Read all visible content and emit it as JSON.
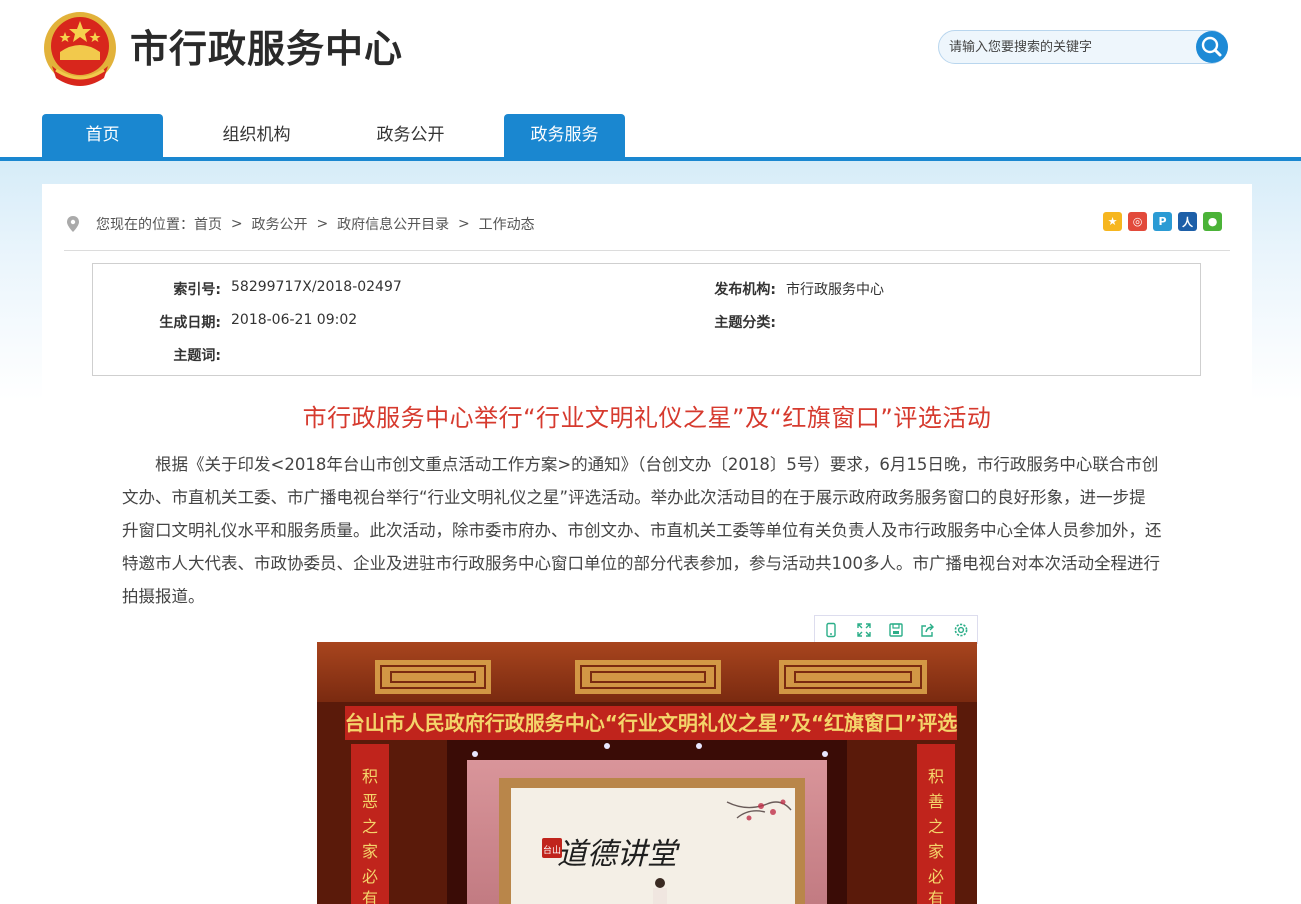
{
  "site": {
    "title": "市行政服务中心"
  },
  "search": {
    "placeholder": "请输入您要搜索的关键字"
  },
  "nav": {
    "items": [
      {
        "label": "首页",
        "active": true
      },
      {
        "label": "组织机构",
        "active": false
      },
      {
        "label": "政务公开",
        "active": false
      },
      {
        "label": "政务服务",
        "active": true
      }
    ]
  },
  "breadcrumb": {
    "prefix": "您现在的位置：",
    "items": [
      "首页",
      "政务公开",
      "政府信息公开目录",
      "工作动态"
    ],
    "separator": ">"
  },
  "share": {
    "icons": [
      {
        "name": "qzone-icon",
        "color": "#f6b61f"
      },
      {
        "name": "weibo-icon",
        "color": "#e24a3b"
      },
      {
        "name": "tencent-weibo-icon",
        "color": "#2b9bd4"
      },
      {
        "name": "renren-icon",
        "color": "#1d5fa8"
      },
      {
        "name": "wechat-icon",
        "color": "#4bb338"
      }
    ]
  },
  "meta": {
    "index_label": "索引号:",
    "index_value": "58299717X/2018-02497",
    "publisher_label": "发布机构:",
    "publisher_value": "市行政服务中心",
    "date_label": "生成日期:",
    "date_value": "2018-06-21 09:02",
    "category_label": "主题分类:",
    "category_value": "",
    "keywords_label": "主题词:",
    "keywords_value": ""
  },
  "article": {
    "title": "市行政服务中心举行“行业文明礼仪之星”及“红旗窗口”评选活动",
    "body": "根据《关于印发<2018年台山市创文重点活动工作方案>的通知》（台创文办〔2018〕5号）要求，6月15日晚，市行政服务中心联合市创文办、市直机关工委、市广播电视台举行“行业文明礼仪之星”评选活动。举办此次活动目的在于展示政府政务服务窗口的良好形象，进一步提升窗口文明礼仪水平和服务质量。此次活动，除市委市府办、市创文办、市直机关工委等单位有关负责人及市行政服务中心全体人员参加外，还特邀市人大代表、市政协委员、企业及进驻市行政服务中心窗口单位的部分代表参加，参与活动共100多人。市广播电视台对本次活动全程进行拍摄报道。"
  },
  "image_toolbar": {
    "tools": [
      "mobile-view-icon",
      "fullscreen-icon",
      "save-icon",
      "share-icon",
      "settings-icon"
    ]
  },
  "photo": {
    "banner_text": "台山市人民政府行政服务中心“行业文明礼仪之星”及“红旗窗口”评选",
    "left_couplet": "积恶之家必有",
    "right_couplet": "积善之家必有",
    "board_title": "道德讲堂",
    "board_badge": "台山"
  }
}
